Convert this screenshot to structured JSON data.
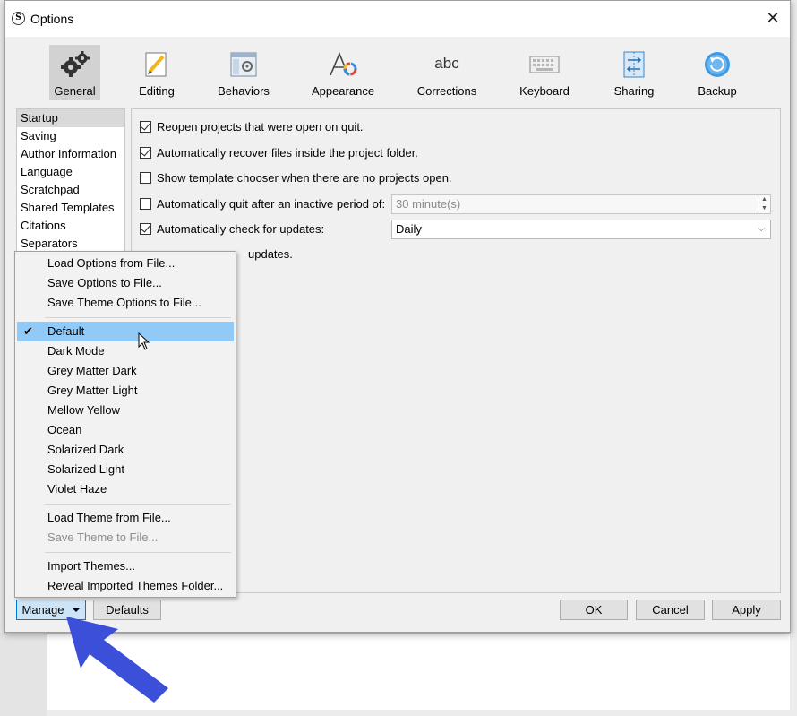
{
  "window": {
    "title": "Options"
  },
  "toolbar": {
    "items": [
      {
        "label": "General",
        "icon": "gears-icon"
      },
      {
        "label": "Editing",
        "icon": "pencil-icon"
      },
      {
        "label": "Behaviors",
        "icon": "window-gear-icon"
      },
      {
        "label": "Appearance",
        "icon": "font-color-icon"
      },
      {
        "label": "Corrections",
        "icon": "abc-icon"
      },
      {
        "label": "Keyboard",
        "icon": "keyboard-icon"
      },
      {
        "label": "Sharing",
        "icon": "sync-arrows-icon"
      },
      {
        "label": "Backup",
        "icon": "backup-icon"
      }
    ],
    "active": "General",
    "corrections_icon_text": "abc"
  },
  "categories": [
    "Startup",
    "Saving",
    "Author Information",
    "Language",
    "Scratchpad",
    "Shared Templates",
    "Citations",
    "Separators"
  ],
  "settings": {
    "reopen": {
      "label": "Reopen projects that were open on quit.",
      "checked": true
    },
    "recover": {
      "label": "Automatically recover files inside the project folder.",
      "checked": true
    },
    "template": {
      "label": "Show template chooser when there are no projects open.",
      "checked": false
    },
    "autoquit": {
      "label": "Automatically quit after an inactive period of:",
      "checked": false,
      "value": "30 minute(s)"
    },
    "updates": {
      "label": "Automatically check for updates:",
      "checked": true,
      "value": "Daily"
    },
    "beta_partial": "updates."
  },
  "menu": {
    "group1": [
      "Load Options from File...",
      "Save Options to File...",
      "Save Theme Options to File..."
    ],
    "themes": [
      "Default",
      "Dark Mode",
      "Grey Matter Dark",
      "Grey Matter Light",
      "Mellow Yellow",
      "Ocean",
      "Solarized Dark",
      "Solarized Light",
      "Violet Haze"
    ],
    "selected_theme": "Default",
    "group3": [
      "Load Theme from File...",
      "Save Theme to File..."
    ],
    "group4": [
      "Import Themes...",
      "Reveal Imported Themes Folder..."
    ]
  },
  "buttons": {
    "manage": "Manage",
    "defaults": "Defaults",
    "ok": "OK",
    "cancel": "Cancel",
    "apply": "Apply"
  },
  "colors": {
    "highlight": "#91c9f7",
    "annotation_arrow": "#3b4fd8",
    "accent": "#0078d7"
  }
}
